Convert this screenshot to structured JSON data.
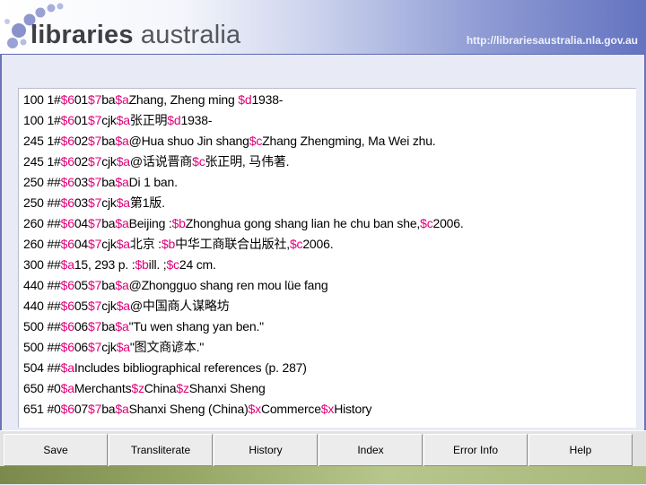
{
  "banner": {
    "logo_bold": "libraries",
    "logo_light": "australia",
    "url": "http://librariesaustralia.nla.gov.au"
  },
  "record_lines": [
    [
      {
        "t": "100 1#"
      },
      {
        "t": "$6",
        "c": 1
      },
      {
        "t": "01"
      },
      {
        "t": "$7",
        "c": 1
      },
      {
        "t": "ba"
      },
      {
        "t": "$a",
        "c": 1
      },
      {
        "t": "Zhang, Zheng ming "
      },
      {
        "t": "$d",
        "c": 1
      },
      {
        "t": "1938-"
      }
    ],
    [
      {
        "t": "100 1#"
      },
      {
        "t": "$6",
        "c": 1
      },
      {
        "t": "01"
      },
      {
        "t": "$7",
        "c": 1
      },
      {
        "t": "cjk"
      },
      {
        "t": "$a",
        "c": 1
      },
      {
        "t": "张正明"
      },
      {
        "t": "$d",
        "c": 1
      },
      {
        "t": "1938-"
      }
    ],
    [
      {
        "t": "245 1#"
      },
      {
        "t": "$6",
        "c": 1
      },
      {
        "t": "02"
      },
      {
        "t": "$7",
        "c": 1
      },
      {
        "t": "ba"
      },
      {
        "t": "$a",
        "c": 1
      },
      {
        "t": "@Hua shuo Jin shang"
      },
      {
        "t": "$c",
        "c": 1
      },
      {
        "t": "Zhang Zhengming, Ma Wei zhu."
      }
    ],
    [
      {
        "t": "245 1#"
      },
      {
        "t": "$6",
        "c": 1
      },
      {
        "t": "02"
      },
      {
        "t": "$7",
        "c": 1
      },
      {
        "t": "cjk"
      },
      {
        "t": "$a",
        "c": 1
      },
      {
        "t": "@话说晋商"
      },
      {
        "t": "$c",
        "c": 1
      },
      {
        "t": "张正明, 马伟著."
      }
    ],
    [
      {
        "t": "250 ##"
      },
      {
        "t": "$6",
        "c": 1
      },
      {
        "t": "03"
      },
      {
        "t": "$7",
        "c": 1
      },
      {
        "t": "ba"
      },
      {
        "t": "$a",
        "c": 1
      },
      {
        "t": "Di 1 ban."
      }
    ],
    [
      {
        "t": "250 ##"
      },
      {
        "t": "$6",
        "c": 1
      },
      {
        "t": "03"
      },
      {
        "t": "$7",
        "c": 1
      },
      {
        "t": "cjk"
      },
      {
        "t": "$a",
        "c": 1
      },
      {
        "t": "第1版."
      }
    ],
    [
      {
        "t": "260 ##"
      },
      {
        "t": "$6",
        "c": 1
      },
      {
        "t": "04"
      },
      {
        "t": "$7",
        "c": 1
      },
      {
        "t": "ba"
      },
      {
        "t": "$a",
        "c": 1
      },
      {
        "t": "Beijing :"
      },
      {
        "t": "$b",
        "c": 1
      },
      {
        "t": "Zhonghua gong shang lian he chu ban she,"
      },
      {
        "t": "$c",
        "c": 1
      },
      {
        "t": "2006."
      }
    ],
    [
      {
        "t": "260 ##"
      },
      {
        "t": "$6",
        "c": 1
      },
      {
        "t": "04"
      },
      {
        "t": "$7",
        "c": 1
      },
      {
        "t": "cjk"
      },
      {
        "t": "$a",
        "c": 1
      },
      {
        "t": "北京 :"
      },
      {
        "t": "$b",
        "c": 1
      },
      {
        "t": "中华工商联合出版社,"
      },
      {
        "t": "$c",
        "c": 1
      },
      {
        "t": "2006."
      }
    ],
    [
      {
        "t": "300 ##"
      },
      {
        "t": "$a",
        "c": 1
      },
      {
        "t": "15, 293 p. :"
      },
      {
        "t": "$b",
        "c": 1
      },
      {
        "t": "ill. ;"
      },
      {
        "t": "$c",
        "c": 1
      },
      {
        "t": "24 cm."
      }
    ],
    [
      {
        "t": "440 ##"
      },
      {
        "t": "$6",
        "c": 1
      },
      {
        "t": "05"
      },
      {
        "t": "$7",
        "c": 1
      },
      {
        "t": "ba"
      },
      {
        "t": "$a",
        "c": 1
      },
      {
        "t": "@Zhongguo shang ren mou lüe fang"
      }
    ],
    [
      {
        "t": "440 ##"
      },
      {
        "t": "$6",
        "c": 1
      },
      {
        "t": "05"
      },
      {
        "t": "$7",
        "c": 1
      },
      {
        "t": "cjk"
      },
      {
        "t": "$a",
        "c": 1
      },
      {
        "t": "@中国商人谋略坊"
      }
    ],
    [
      {
        "t": "500 ##"
      },
      {
        "t": "$6",
        "c": 1
      },
      {
        "t": "06"
      },
      {
        "t": "$7",
        "c": 1
      },
      {
        "t": "ba"
      },
      {
        "t": "$a",
        "c": 1
      },
      {
        "t": "\"Tu wen shang yan ben.\""
      }
    ],
    [
      {
        "t": "500 ##"
      },
      {
        "t": "$6",
        "c": 1
      },
      {
        "t": "06"
      },
      {
        "t": "$7",
        "c": 1
      },
      {
        "t": "cjk"
      },
      {
        "t": "$a",
        "c": 1
      },
      {
        "t": "\"图文商谚本.\""
      }
    ],
    [
      {
        "t": "504 ##"
      },
      {
        "t": "$a",
        "c": 1
      },
      {
        "t": "Includes bibliographical references (p. 287)"
      }
    ],
    [
      {
        "t": "650 #0"
      },
      {
        "t": "$a",
        "c": 1
      },
      {
        "t": "Merchants"
      },
      {
        "t": "$z",
        "c": 1
      },
      {
        "t": "China"
      },
      {
        "t": "$z",
        "c": 1
      },
      {
        "t": "Shanxi Sheng"
      }
    ],
    [
      {
        "t": "651 #0"
      },
      {
        "t": "$6",
        "c": 1
      },
      {
        "t": "07"
      },
      {
        "t": "$7",
        "c": 1
      },
      {
        "t": "ba"
      },
      {
        "t": "$a",
        "c": 1
      },
      {
        "t": "Shanxi Sheng (China)"
      },
      {
        "t": "$x",
        "c": 1
      },
      {
        "t": "Commerce"
      },
      {
        "t": "$x",
        "c": 1
      },
      {
        "t": "History"
      }
    ]
  ],
  "buttons": {
    "save": "Save",
    "transliterate": "Transliterate",
    "history": "History",
    "index": "Index",
    "error_info": "Error Info",
    "help": "Help"
  },
  "colors": {
    "subfield_code": "#e0007a",
    "frame": "#5a67b0"
  }
}
